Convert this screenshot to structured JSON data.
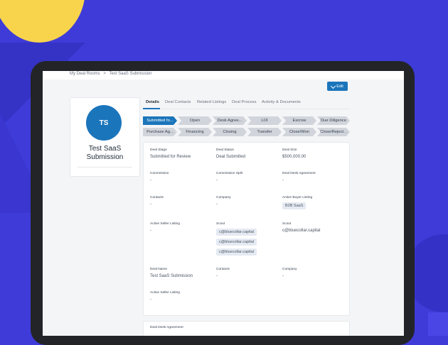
{
  "breadcrumb": [
    "My Deal Rooms",
    ">",
    "Test SaaS Submission"
  ],
  "edit_label": "Edit",
  "profile": {
    "initials": "TS",
    "name_line1": "Test SaaS",
    "name_line2": "Submission"
  },
  "tabs": [
    "Details",
    "Deal Contacts",
    "Related Listings",
    "Deal Process",
    "Activity & Documents"
  ],
  "stages_row1": [
    "Submitted fo...",
    "Open",
    "Desk Agree...",
    "LOI",
    "Escrow",
    "Due Diligence"
  ],
  "stages_row2": [
    "Purchase Ag...",
    "Financing",
    "Closing",
    "Transfer",
    "Close/Won",
    "Close/Reject..."
  ],
  "fields": {
    "deal_stage": {
      "label": "Deal Stage",
      "value": "Submitted for Review"
    },
    "deal_status": {
      "label": "Deal Status",
      "value": "Deal Submitted"
    },
    "deal_size": {
      "label": "Deal Size",
      "value": "$500,000.00"
    },
    "commission": {
      "label": "Commission",
      "value": "-"
    },
    "commission_split": {
      "label": "Commission Split",
      "value": "-"
    },
    "deal_desk_agreement": {
      "label": "Deal Desk Agreement",
      "value": "-"
    },
    "contacts": {
      "label": "Contacts",
      "value": "-"
    },
    "company": {
      "label": "Company",
      "value": "-"
    },
    "active_buyer_listing": {
      "label": "Active Buyer Listing",
      "value": "B2B SaaS"
    },
    "active_seller_listing": {
      "label": "Active Seller Listing",
      "value": "-"
    },
    "scout_chips": {
      "label": "Scout",
      "values": [
        "c@bluecollar.capital",
        "c@bluecollar.capital",
        "c@bluecollar.capital"
      ]
    },
    "scout_text": {
      "label": "Scout",
      "value": "c@bluecollar.capital"
    },
    "deal_name": {
      "label": "Deal Name",
      "value": "Test SaaS Submission"
    },
    "contacts2": {
      "label": "Contacts",
      "value": "-"
    },
    "company2": {
      "label": "Company",
      "value": "-"
    },
    "active_seller_listing2": {
      "label": "Active Seller Listing",
      "value": "-"
    }
  },
  "card2_label": "Deal Desk Agreement",
  "colors": {
    "accent": "#1b75bb",
    "background": "#3f3bd8",
    "sun": "#f8d44c"
  }
}
